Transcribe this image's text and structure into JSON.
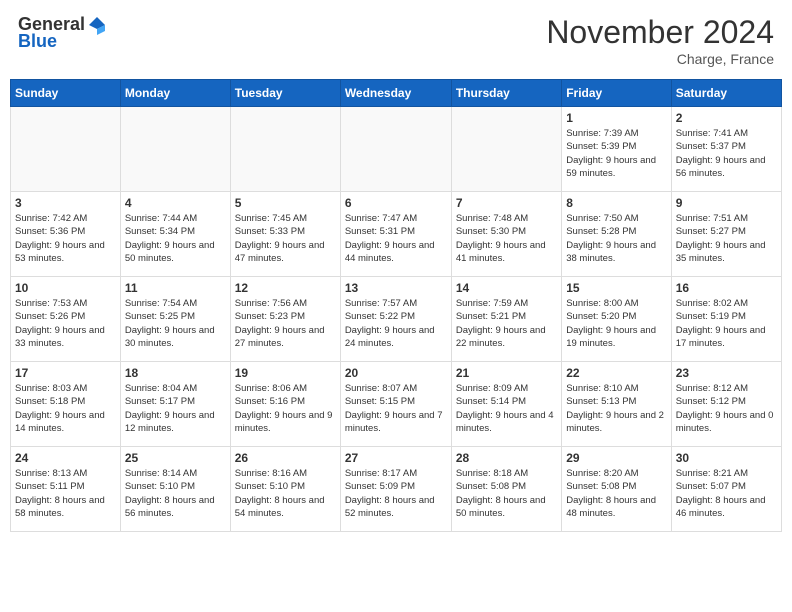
{
  "header": {
    "logo_general": "General",
    "logo_blue": "Blue",
    "month_title": "November 2024",
    "location": "Charge, France"
  },
  "weekdays": [
    "Sunday",
    "Monday",
    "Tuesday",
    "Wednesday",
    "Thursday",
    "Friday",
    "Saturday"
  ],
  "weeks": [
    [
      {
        "day": "",
        "info": ""
      },
      {
        "day": "",
        "info": ""
      },
      {
        "day": "",
        "info": ""
      },
      {
        "day": "",
        "info": ""
      },
      {
        "day": "",
        "info": ""
      },
      {
        "day": "1",
        "info": "Sunrise: 7:39 AM\nSunset: 5:39 PM\nDaylight: 9 hours and 59 minutes."
      },
      {
        "day": "2",
        "info": "Sunrise: 7:41 AM\nSunset: 5:37 PM\nDaylight: 9 hours and 56 minutes."
      }
    ],
    [
      {
        "day": "3",
        "info": "Sunrise: 7:42 AM\nSunset: 5:36 PM\nDaylight: 9 hours and 53 minutes."
      },
      {
        "day": "4",
        "info": "Sunrise: 7:44 AM\nSunset: 5:34 PM\nDaylight: 9 hours and 50 minutes."
      },
      {
        "day": "5",
        "info": "Sunrise: 7:45 AM\nSunset: 5:33 PM\nDaylight: 9 hours and 47 minutes."
      },
      {
        "day": "6",
        "info": "Sunrise: 7:47 AM\nSunset: 5:31 PM\nDaylight: 9 hours and 44 minutes."
      },
      {
        "day": "7",
        "info": "Sunrise: 7:48 AM\nSunset: 5:30 PM\nDaylight: 9 hours and 41 minutes."
      },
      {
        "day": "8",
        "info": "Sunrise: 7:50 AM\nSunset: 5:28 PM\nDaylight: 9 hours and 38 minutes."
      },
      {
        "day": "9",
        "info": "Sunrise: 7:51 AM\nSunset: 5:27 PM\nDaylight: 9 hours and 35 minutes."
      }
    ],
    [
      {
        "day": "10",
        "info": "Sunrise: 7:53 AM\nSunset: 5:26 PM\nDaylight: 9 hours and 33 minutes."
      },
      {
        "day": "11",
        "info": "Sunrise: 7:54 AM\nSunset: 5:25 PM\nDaylight: 9 hours and 30 minutes."
      },
      {
        "day": "12",
        "info": "Sunrise: 7:56 AM\nSunset: 5:23 PM\nDaylight: 9 hours and 27 minutes."
      },
      {
        "day": "13",
        "info": "Sunrise: 7:57 AM\nSunset: 5:22 PM\nDaylight: 9 hours and 24 minutes."
      },
      {
        "day": "14",
        "info": "Sunrise: 7:59 AM\nSunset: 5:21 PM\nDaylight: 9 hours and 22 minutes."
      },
      {
        "day": "15",
        "info": "Sunrise: 8:00 AM\nSunset: 5:20 PM\nDaylight: 9 hours and 19 minutes."
      },
      {
        "day": "16",
        "info": "Sunrise: 8:02 AM\nSunset: 5:19 PM\nDaylight: 9 hours and 17 minutes."
      }
    ],
    [
      {
        "day": "17",
        "info": "Sunrise: 8:03 AM\nSunset: 5:18 PM\nDaylight: 9 hours and 14 minutes."
      },
      {
        "day": "18",
        "info": "Sunrise: 8:04 AM\nSunset: 5:17 PM\nDaylight: 9 hours and 12 minutes."
      },
      {
        "day": "19",
        "info": "Sunrise: 8:06 AM\nSunset: 5:16 PM\nDaylight: 9 hours and 9 minutes."
      },
      {
        "day": "20",
        "info": "Sunrise: 8:07 AM\nSunset: 5:15 PM\nDaylight: 9 hours and 7 minutes."
      },
      {
        "day": "21",
        "info": "Sunrise: 8:09 AM\nSunset: 5:14 PM\nDaylight: 9 hours and 4 minutes."
      },
      {
        "day": "22",
        "info": "Sunrise: 8:10 AM\nSunset: 5:13 PM\nDaylight: 9 hours and 2 minutes."
      },
      {
        "day": "23",
        "info": "Sunrise: 8:12 AM\nSunset: 5:12 PM\nDaylight: 9 hours and 0 minutes."
      }
    ],
    [
      {
        "day": "24",
        "info": "Sunrise: 8:13 AM\nSunset: 5:11 PM\nDaylight: 8 hours and 58 minutes."
      },
      {
        "day": "25",
        "info": "Sunrise: 8:14 AM\nSunset: 5:10 PM\nDaylight: 8 hours and 56 minutes."
      },
      {
        "day": "26",
        "info": "Sunrise: 8:16 AM\nSunset: 5:10 PM\nDaylight: 8 hours and 54 minutes."
      },
      {
        "day": "27",
        "info": "Sunrise: 8:17 AM\nSunset: 5:09 PM\nDaylight: 8 hours and 52 minutes."
      },
      {
        "day": "28",
        "info": "Sunrise: 8:18 AM\nSunset: 5:08 PM\nDaylight: 8 hours and 50 minutes."
      },
      {
        "day": "29",
        "info": "Sunrise: 8:20 AM\nSunset: 5:08 PM\nDaylight: 8 hours and 48 minutes."
      },
      {
        "day": "30",
        "info": "Sunrise: 8:21 AM\nSunset: 5:07 PM\nDaylight: 8 hours and 46 minutes."
      }
    ]
  ]
}
